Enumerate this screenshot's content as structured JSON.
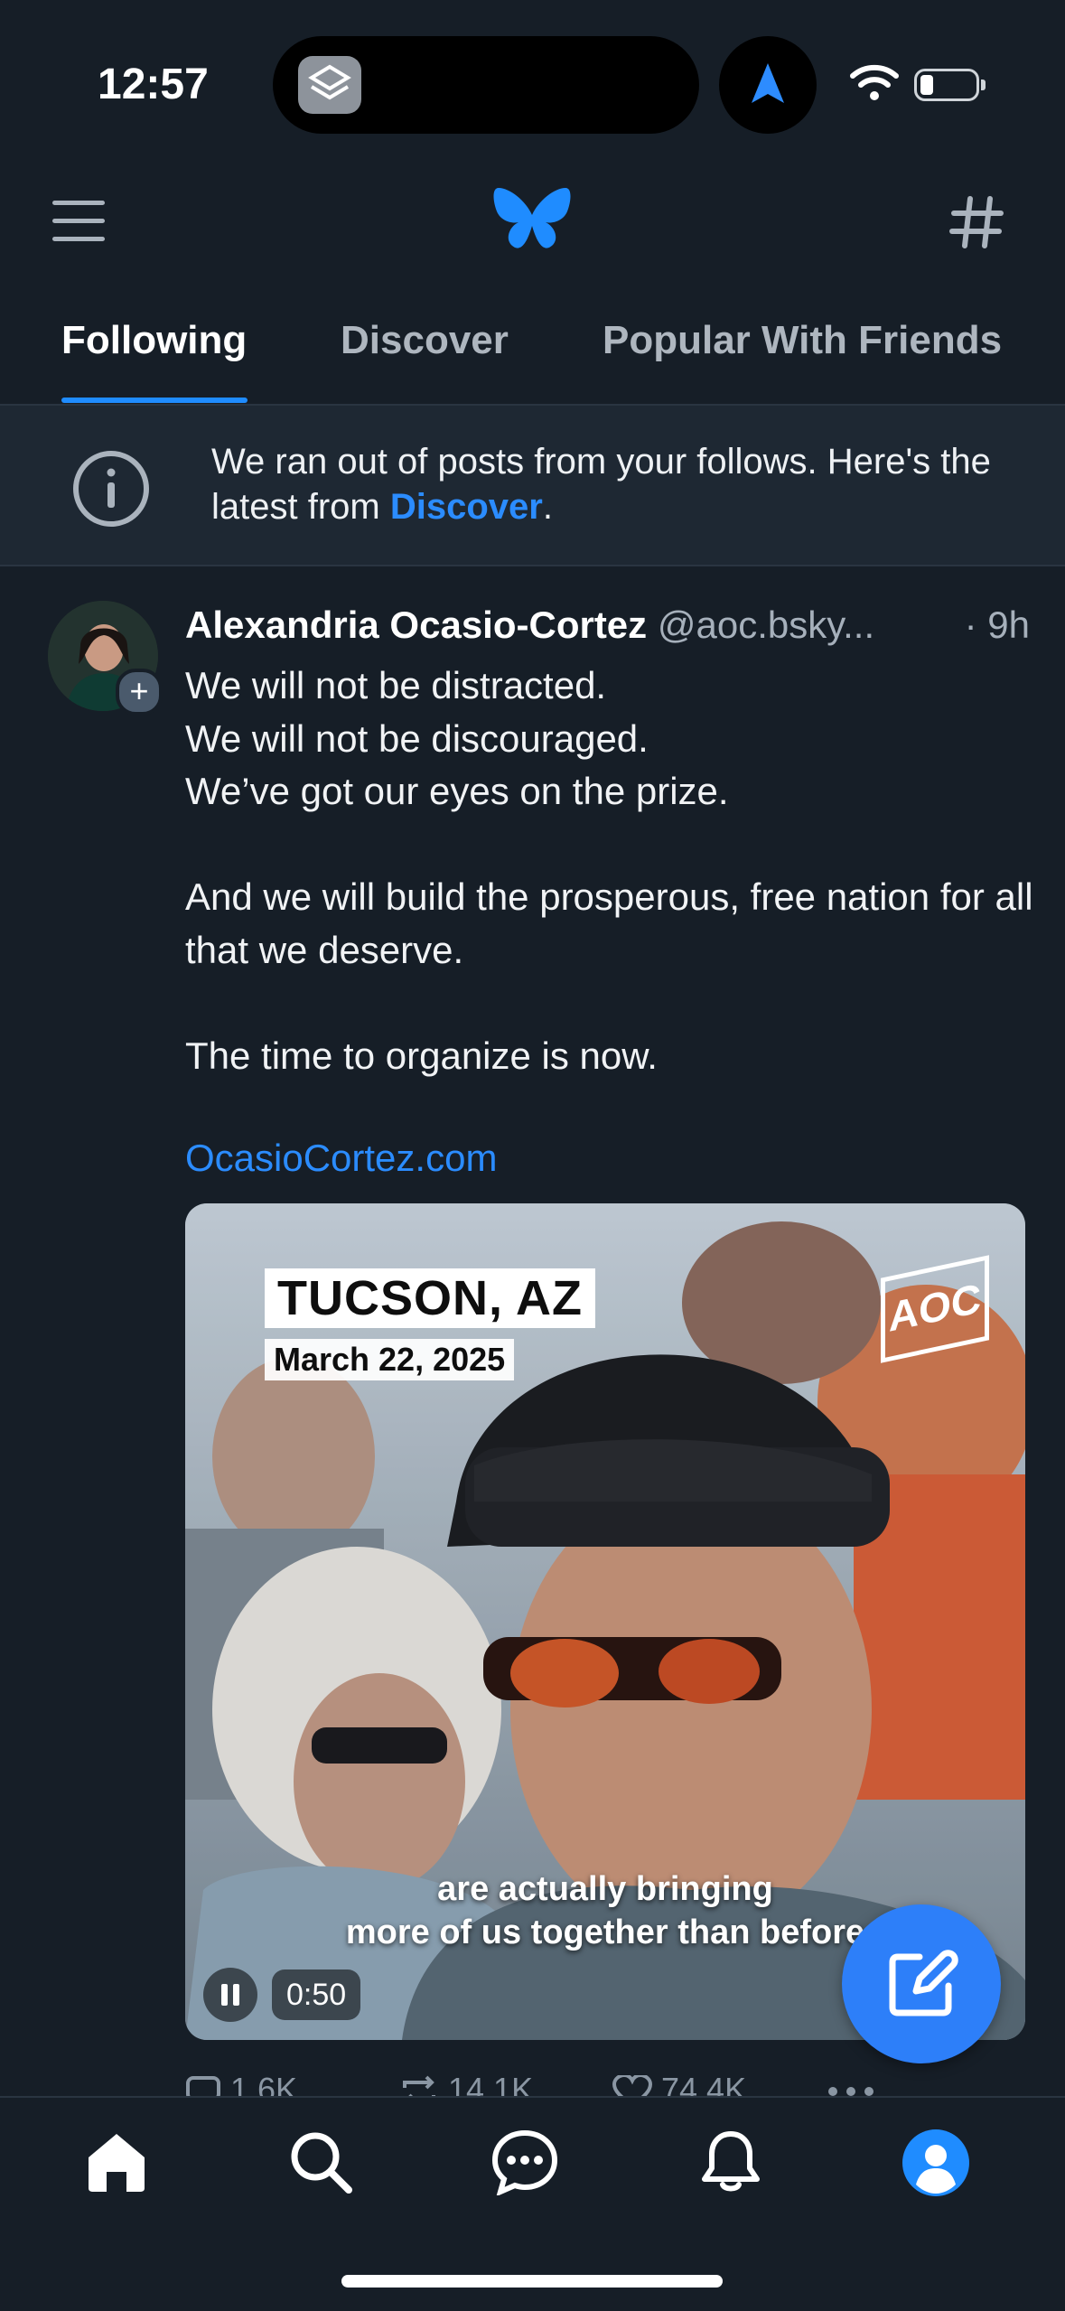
{
  "status_bar": {
    "time": "12:57"
  },
  "tabs": [
    {
      "label": "Following",
      "active": true
    },
    {
      "label": "Discover",
      "active": false
    },
    {
      "label": "Popular With Friends",
      "active": false
    }
  ],
  "banner": {
    "text_before": "We ran out of posts from your follows. Here's the latest from ",
    "link": "Discover",
    "text_after": "."
  },
  "post": {
    "author_name": "Alexandria Ocasio-Cortez",
    "author_handle": "@aoc.bsky...",
    "time": "· 9h",
    "body": [
      "We will not be distracted.",
      "We will not be discouraged.",
      "We’ve got our eyes on the prize.",
      "",
      "And we will build the prosperous, free nation for all that we deserve.",
      "",
      "The time to organize is now.",
      ""
    ],
    "link": "OcasioCortez.com",
    "video": {
      "city": "TUCSON, AZ",
      "date": "March 22, 2025",
      "logo": "AOC",
      "subtitle_line1": "are actually bringing",
      "subtitle_line2": "more of us together than before",
      "duration": "0:50",
      "playing": true
    },
    "actions": {
      "replies": "1.6K",
      "reposts": "14.1K",
      "likes": "74.4K"
    }
  },
  "colors": {
    "background": "#161e27",
    "accent": "#1f8cff",
    "fab": "#2d7ff9"
  },
  "icons": {
    "menu": "hamburger-icon",
    "logo": "butterfly-logo",
    "feeds": "hash-icon",
    "info": "info-icon",
    "compose": "compose-icon",
    "nav": [
      "home-icon",
      "search-icon",
      "chat-icon",
      "bell-icon",
      "profile-icon"
    ]
  }
}
